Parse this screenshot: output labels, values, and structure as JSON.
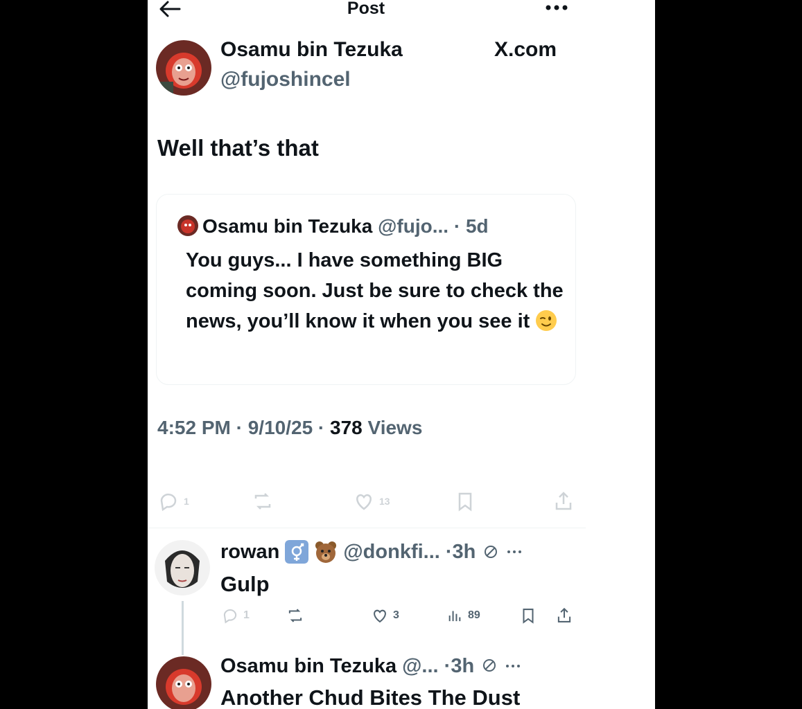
{
  "header": {
    "title": "Post"
  },
  "post": {
    "author_name": "Osamu bin Tezuka",
    "author_handle": "@fujoshincel",
    "source": "X.com",
    "text": "Well that’s that",
    "timestamp": "4:52 PM",
    "date": "9/10/25",
    "views_count": "378",
    "views_label": "Views",
    "separator": " · ",
    "counts": {
      "replies": "1",
      "likes": "13"
    }
  },
  "quote": {
    "author_name": "Osamu bin Tezuka",
    "handle": "@fujo...",
    "age": "· 5d",
    "text": "You guys... I have something BIG coming soon. Just be sure to check the news, you’ll know it when you see it"
  },
  "replies": [
    {
      "author_name": "rowan",
      "handle": "@donkfi...",
      "age": "·3h",
      "text": "Gulp",
      "counts": {
        "replies": "1",
        "likes": "3",
        "views": "89"
      }
    },
    {
      "author_name": "Osamu bin Tezuka",
      "handle": "@...",
      "age": "·3h",
      "text": "Another Chud Bites The Dust"
    }
  ],
  "icons": {
    "back": "arrow-left-icon",
    "more": "more-horizontal-icon",
    "reply": "reply-bubble-icon",
    "repost": "repost-icon",
    "like": "heart-icon",
    "bookmark": "bookmark-icon",
    "share": "share-icon",
    "views": "views-bar-icon",
    "wink": "winking-face-emoji",
    "trans_flag": "trans-symbol-badge",
    "bear": "bear-emoji",
    "slash": "no-entry-icon"
  },
  "colors": {
    "text": "#0f1419",
    "muted": "#536471",
    "border": "#eff3f4",
    "frame": "#000000"
  }
}
